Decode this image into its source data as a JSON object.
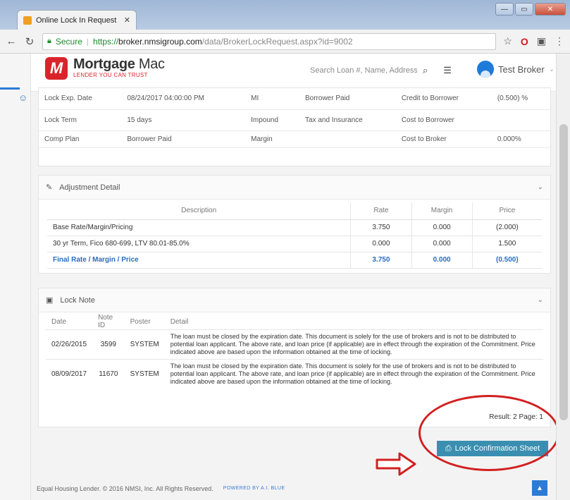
{
  "browser": {
    "tab_title": "Online Lock In Request",
    "secure_label": "Secure",
    "url_scheme": "https://",
    "url_host": "broker.nmsigroup.com",
    "url_path": "/data/BrokerLockRequest.aspx?id=9002"
  },
  "header": {
    "brand_name": "Mortgage",
    "brand_name2": "Mac",
    "tagline": "LENDER YOU CAN TRUST",
    "search_placeholder": "Search Loan #, Name, Address",
    "user_name": "Test Broker"
  },
  "loan_details": {
    "rows": [
      [
        "Lock Exp. Date",
        "08/24/2017  04:00:00 PM",
        "MI",
        "Borrower Paid",
        "Credit to Borrower",
        "(0.500) %"
      ],
      [
        "Lock Term",
        "15 days",
        "Impound",
        "Tax and Insurance",
        "Cost to Borrower",
        ""
      ],
      [
        "Comp Plan",
        "Borrower Paid",
        "Margin",
        "",
        "Cost to Broker",
        "0.000%"
      ]
    ]
  },
  "adjustment": {
    "title": "Adjustment Detail",
    "headers": [
      "Description",
      "Rate",
      "Margin",
      "Price"
    ],
    "rows": [
      [
        "Base Rate/Margin/Pricing",
        "3.750",
        "0.000",
        "(2.000)"
      ],
      [
        "30 yr Term, Fico 680-699, LTV 80.01-85.0%",
        "0.000",
        "0.000",
        "1.500"
      ]
    ],
    "final": [
      "Final Rate / Margin / Price",
      "3.750",
      "0.000",
      "(0.500)"
    ]
  },
  "lock_note": {
    "title": "Lock Note",
    "headers": [
      "Date",
      "Note ID",
      "Poster",
      "Detail"
    ],
    "rows": [
      [
        "02/26/2015",
        "3599",
        "SYSTEM",
        "The loan must be closed by the expiration date. This document is solely for the use of brokers and is not to be distributed to potential loan applicant. The above rate, and loan price (if applicable) are in effect through the expiration of the Commitment. Price indicated above are based upon the information obtained at the time of locking."
      ],
      [
        "08/09/2017",
        "11670",
        "SYSTEM",
        "The loan must be closed by the expiration date. This document is solely for the use of brokers and is not to be distributed to potential loan applicant. The above rate, and loan price (if applicable) are in effect through the expiration of the Commitment. Price indicated above are based upon the information obtained at the time of locking."
      ]
    ],
    "result_text": "Result: 2  Page: 1"
  },
  "actions": {
    "confirm_label": "Lock Confirmation Sheet"
  },
  "footer": {
    "copyright": "Equal Housing Lender. © 2016 NMSI, Inc. All Rights Reserved.",
    "powered": "POWERED BY A.I. BLUE"
  },
  "colors": {
    "accent": "#2d7bd4",
    "brand_red": "#d9242b",
    "button": "#3a8fb0",
    "annotation_red": "#d22020"
  }
}
